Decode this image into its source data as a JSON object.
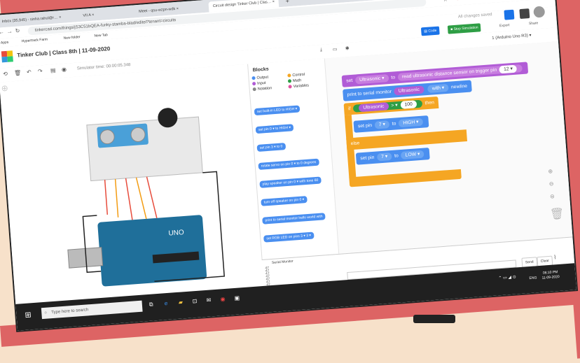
{
  "colors": {
    "frame_red": "#dd6464",
    "code_orange": "#f5a623",
    "code_purple": "#b15cd6",
    "code_blue": "#4a8ff0",
    "tc_green": "#2e9e45",
    "tc_blue": "#1a73e8"
  },
  "browser": {
    "tabs": [
      {
        "label": "Inbox (35,945) - sinha.rahul@r… ×"
      },
      {
        "label": "VII A ×"
      },
      {
        "label": "Meet - qsu-wzpn-wdk ×"
      },
      {
        "label": "Circuit design Tinker Club | Clas… ×"
      }
    ],
    "new_tab_label": "+",
    "url": "tinkercad.com/things/jS3C51bQEA-funky-stamba-blad/editel?tenant=circuits",
    "bookmarks": [
      "Apps",
      "Hypertrack Farm",
      "New folder",
      "New Tab"
    ]
  },
  "tinkercad": {
    "saved_status": "All changes saved",
    "title": "Tinker Club | Class 8th | 11-09-2020",
    "code_button": "Code",
    "stop_button": "Stop Simulation",
    "export_button": "Export",
    "share_button": "Share",
    "simulator_time": "Simulator time: 00:00:05.348",
    "device_select": "1 (Arduino Uno R3)"
  },
  "blocks_panel": {
    "title": "Blocks",
    "categories": [
      {
        "label": "Output",
        "color": "#4a8ff0"
      },
      {
        "label": "Control",
        "color": "#f5a623"
      },
      {
        "label": "Input",
        "color": "#b15cd6"
      },
      {
        "label": "Math",
        "color": "#2e9e45"
      },
      {
        "label": "Notation",
        "color": "#888888"
      },
      {
        "label": "Variables",
        "color": "#e052a0"
      }
    ],
    "palette": [
      "set built-in LED to HIGH ▾",
      "set pin 0 ▾ to HIGH ▾",
      "set pin 3 ▾ to 0",
      "rotate servo on pin 0 ▾ to 0 degrees",
      "play speaker on pin 0 ▾ with tone 60",
      "turn off speaker on pin 0 ▾",
      "print to serial monitor hello world with",
      "set RGB LED on pins 3 ▾ 3 ▾"
    ]
  },
  "code": {
    "set_kw": "set",
    "var_name": "Ultrasonic ▾",
    "to_kw": "to",
    "sensor_text": "read ultrasonic distance sensor on trigger pin",
    "trigger_pin": "12 ▾",
    "print_text": "print to serial monitor",
    "print_var": "Ultrasonic",
    "with_kw": "with ▾",
    "newline_kw": "newline",
    "if_kw": "if",
    "cond_var": "Ultrasonic",
    "operator": "> ▾",
    "threshold": "100",
    "then_kw": "then",
    "set_pin_kw": "set pin",
    "pin_num": "7 ▾",
    "high_val": "HIGH ▾",
    "else_kw": "else",
    "low_val": "LOW ▾"
  },
  "serial": {
    "title": "Serial Monitor",
    "lines": [
      "47",
      "47",
      "47",
      "47",
      "47",
      "47",
      "47"
    ],
    "send_button": "Send",
    "clear_button": "Clear"
  },
  "taskbar": {
    "search_placeholder": "Type here to search",
    "lang": "ENG",
    "time": "06:10 PM",
    "date": "11-09-2020"
  },
  "board_label": "UNO"
}
